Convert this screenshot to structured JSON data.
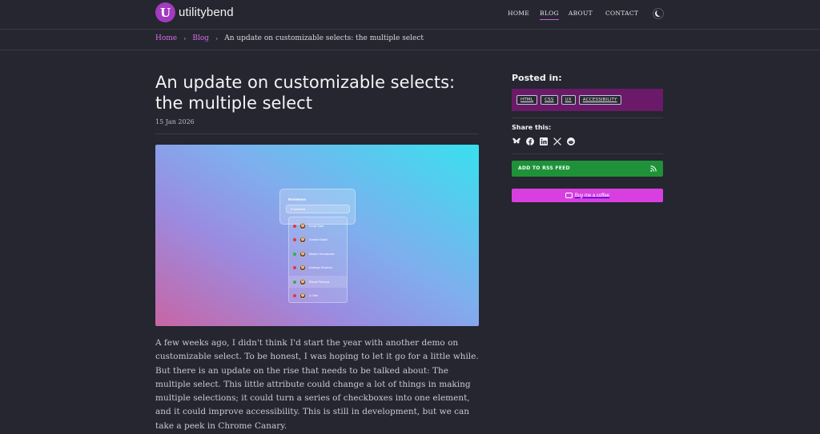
{
  "site": {
    "logo_letter": "U",
    "name": "utilitybend"
  },
  "nav": {
    "items": [
      {
        "label": "HOME",
        "active": false
      },
      {
        "label": "BLOG",
        "active": true
      },
      {
        "label": "ABOUT",
        "active": false
      },
      {
        "label": "CONTACT",
        "active": false
      }
    ],
    "theme_toggle_icon": "moon-icon"
  },
  "breadcrumb": {
    "home": "Home",
    "blog": "Blog",
    "current": "An update on customizable selects: the multiple select"
  },
  "post": {
    "title": "An update on customizable selects: the multiple select",
    "date": "15 Jan 2026",
    "hero": {
      "select_label": "Reviewers",
      "select_value": "2 selected",
      "options": [
        {
          "name": "Kenji Sato",
          "status_color": "#e0363e"
        },
        {
          "name": "Amara Diallo",
          "status_color": "#e0363e"
        },
        {
          "name": "Mateo Hernandez",
          "status_color": "#2fae4e"
        },
        {
          "name": "Ananya Sharma",
          "status_color": "#e0363e"
        },
        {
          "name": "Elena Petrova",
          "status_color": "#2fae4e"
        },
        {
          "name": "Li Wei",
          "status_color": "#e0363e"
        }
      ]
    },
    "body": "A few weeks ago, I didn't think I'd start the year with another demo on customizable select. To be honest, I was hoping to let it go for a little while. But there is an update on the rise that needs to be talked about: The multiple select. This little attribute could change a lot of things in making multiple selections; it could turn a series of checkboxes into one element, and it could improve accessibility. This is still in development, but we can take a peek in Chrome Canary."
  },
  "sidebar": {
    "posted_in_heading": "Posted in:",
    "tags": [
      "HTML",
      "CSS",
      "UX",
      "ACCESSIBILITY"
    ],
    "share_heading": "Share this:",
    "share_icons": [
      "bluesky-icon",
      "facebook-icon",
      "linkedin-icon",
      "x-icon",
      "reddit-icon"
    ],
    "rss_label": "ADD TO RSS FEED",
    "coffee_label": "Buy me a coffee"
  },
  "colors": {
    "accent": "#d66ee8",
    "tags_bg": "#6a1a68",
    "rss_bg": "#1f9239",
    "coffee_bg": "#d93fe0",
    "page_bg": "#25262f"
  }
}
